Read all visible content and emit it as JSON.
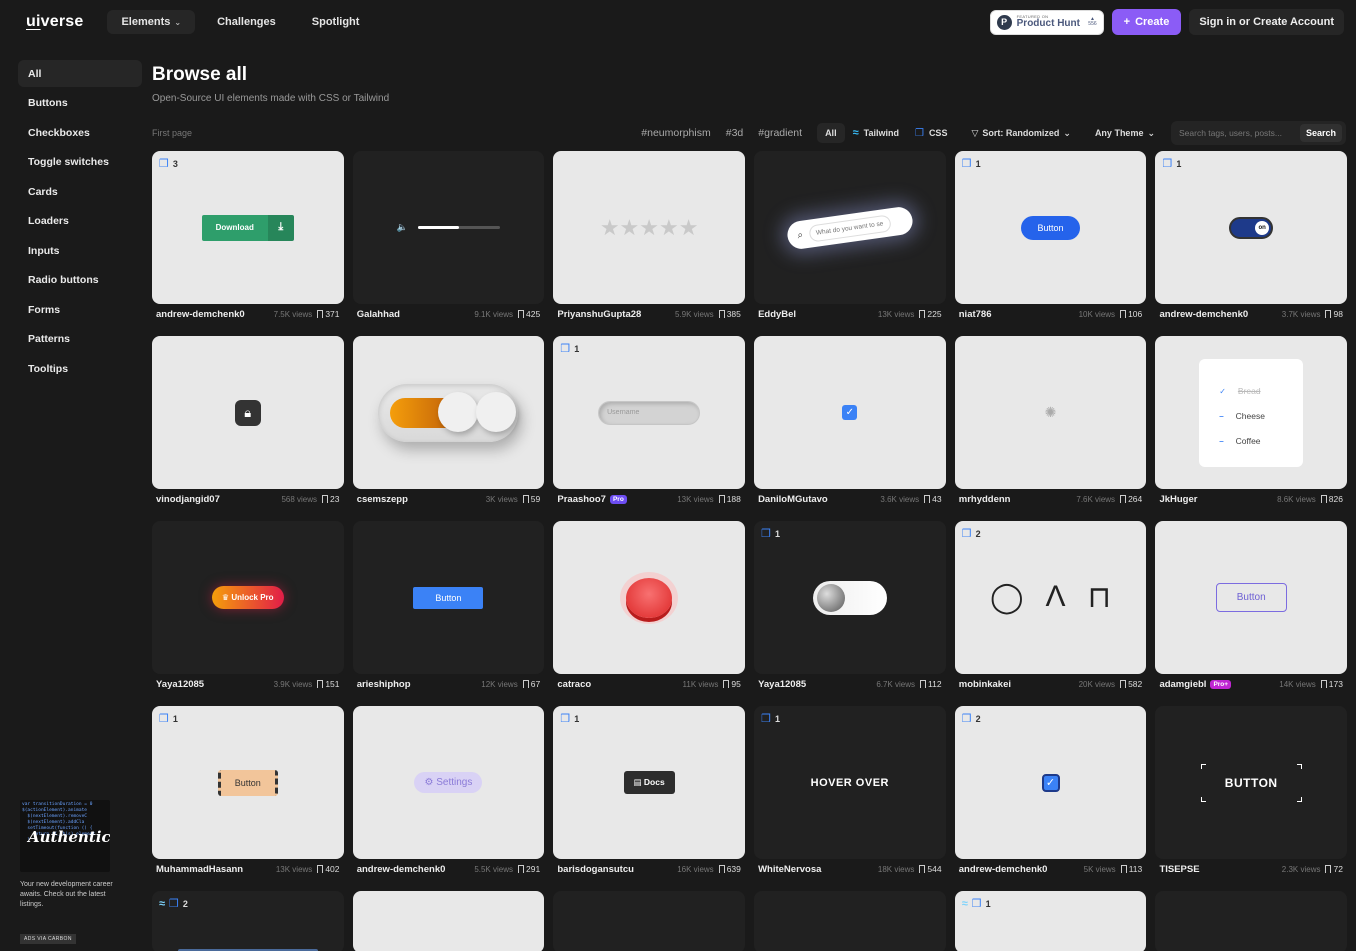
{
  "header": {
    "logo_prefix": "ui",
    "logo_suffix": "verse",
    "nav": [
      "Elements",
      "Challenges",
      "Spotlight"
    ],
    "product_hunt_small": "FEATURED ON",
    "product_hunt_name": "Product Hunt",
    "product_hunt_votes": "556",
    "create_label": "Create",
    "signin_label": "Sign in or Create Account"
  },
  "sidebar": {
    "items": [
      "All",
      "Buttons",
      "Checkboxes",
      "Toggle switches",
      "Cards",
      "Loaders",
      "Inputs",
      "Radio buttons",
      "Forms",
      "Patterns",
      "Tooltips"
    ]
  },
  "ad": {
    "signature": "Authentic",
    "text": "Your new development career awaits. Check out the latest listings.",
    "label": "ADS VIA CARBON"
  },
  "main": {
    "title": "Browse all",
    "subtitle": "Open-Source UI elements made with CSS or Tailwind",
    "first_page": "First page",
    "tags": [
      "#neumorphism",
      "#3d",
      "#gradient"
    ],
    "seg": {
      "all": "All",
      "tailwind": "Tailwind",
      "css": "CSS"
    },
    "sort_label": "Sort: Randomized",
    "theme_label": "Any Theme",
    "search_placeholder": "Search tags, users, posts...",
    "search_button": "Search"
  },
  "cards": [
    {
      "author": "andrew-demchenk0",
      "views": "7.5K views",
      "saves": "371",
      "favs": "3",
      "preview": {
        "label": "Download"
      }
    },
    {
      "author": "Galahhad",
      "views": "9.1K views",
      "saves": "425",
      "preview": {
        "volume": 0.5
      }
    },
    {
      "author": "PriyanshuGupta28",
      "views": "5.9K views",
      "saves": "385",
      "preview": {
        "stars": "★★★★★"
      }
    },
    {
      "author": "EddyBel",
      "views": "13K views",
      "saves": "225",
      "preview": {
        "placeholder": "What do you want to se"
      }
    },
    {
      "author": "niat786",
      "views": "10K views",
      "saves": "106",
      "favs": "1",
      "preview": {
        "label": "Button"
      }
    },
    {
      "author": "andrew-demchenk0",
      "views": "3.7K views",
      "saves": "98",
      "favs": "1",
      "preview": {
        "label": "on"
      }
    },
    {
      "author": "vinodjangid07",
      "views": "568 views",
      "saves": "23",
      "preview": {}
    },
    {
      "author": "csemszepp",
      "views": "3K views",
      "saves": "59",
      "preview": {}
    },
    {
      "author": "Praashoo7",
      "badge": "Pro",
      "views": "13K views",
      "saves": "188",
      "favs": "1",
      "preview": {
        "placeholder": "Username"
      }
    },
    {
      "author": "DaniloMGutavo",
      "views": "3.6K views",
      "saves": "43",
      "preview": {}
    },
    {
      "author": "mrhyddenn",
      "views": "7.6K views",
      "saves": "264",
      "preview": {}
    },
    {
      "author": "JkHuger",
      "views": "8.6K views",
      "saves": "826",
      "preview": {
        "items": [
          "Bread",
          "Cheese",
          "Coffee"
        ]
      }
    },
    {
      "author": "Yaya12085",
      "views": "3.9K views",
      "saves": "151",
      "preview": {
        "label": "Unlock Pro"
      }
    },
    {
      "author": "arieshiphop",
      "views": "12K views",
      "saves": "67",
      "preview": {
        "label": "Button"
      }
    },
    {
      "author": "catraco",
      "views": "11K views",
      "saves": "95",
      "preview": {}
    },
    {
      "author": "Yaya12085",
      "views": "6.7K views",
      "saves": "112",
      "favs": "1",
      "preview": {}
    },
    {
      "author": "mobinkakei",
      "views": "20K views",
      "saves": "582",
      "favs": "2",
      "preview": {}
    },
    {
      "author": "adamgiebl",
      "badge": "Pro+",
      "views": "14K views",
      "saves": "173",
      "preview": {
        "label": "Button"
      }
    },
    {
      "author": "MuhammadHasann",
      "views": "13K views",
      "saves": "402",
      "favs": "1",
      "preview": {
        "label": "Button"
      }
    },
    {
      "author": "andrew-demchenk0",
      "views": "5.5K views",
      "saves": "291",
      "preview": {
        "label": "Settings"
      }
    },
    {
      "author": "barisdogansutcu",
      "views": "16K views",
      "saves": "639",
      "favs": "1",
      "preview": {
        "label": "Docs"
      }
    },
    {
      "author": "WhiteNervosa",
      "views": "18K views",
      "saves": "544",
      "favs": "1",
      "preview": {
        "label": "HOVER OVER"
      }
    },
    {
      "author": "andrew-demchenk0",
      "views": "5K views",
      "saves": "113",
      "favs": "2",
      "preview": {}
    },
    {
      "author": "TISEPSE",
      "views": "2.3K views",
      "saves": "72",
      "preview": {
        "label": "BUTTON"
      }
    }
  ],
  "partial_row": [
    {
      "favs": "2"
    },
    {},
    {},
    {},
    {
      "favs": "1"
    },
    {}
  ]
}
